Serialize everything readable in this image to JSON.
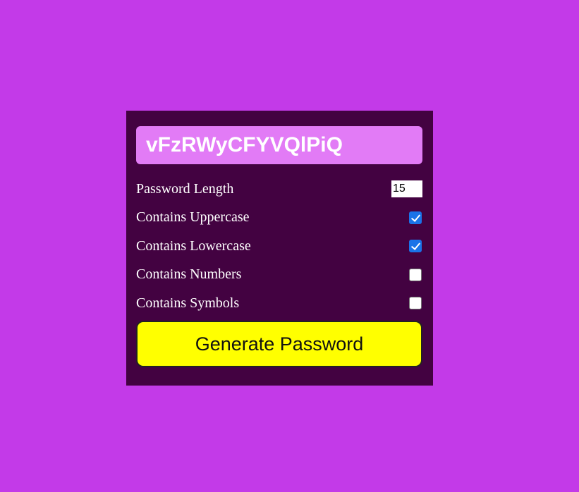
{
  "generator": {
    "password": "vFzRWyCFYVQlPiQ",
    "options": {
      "length": {
        "label": "Password Length",
        "value": "15"
      },
      "uppercase": {
        "label": "Contains Uppercase",
        "checked": true
      },
      "lowercase": {
        "label": "Contains Lowercase",
        "checked": true
      },
      "numbers": {
        "label": "Contains Numbers",
        "checked": false
      },
      "symbols": {
        "label": "Contains Symbols",
        "checked": false
      }
    },
    "generate_label": "Generate Password"
  },
  "colors": {
    "page_background": "#c33ae8",
    "panel_background": "#430241",
    "password_background": "#e27bf6",
    "button_background": "#ffff00",
    "checkbox_checked": "#1a73e8"
  }
}
